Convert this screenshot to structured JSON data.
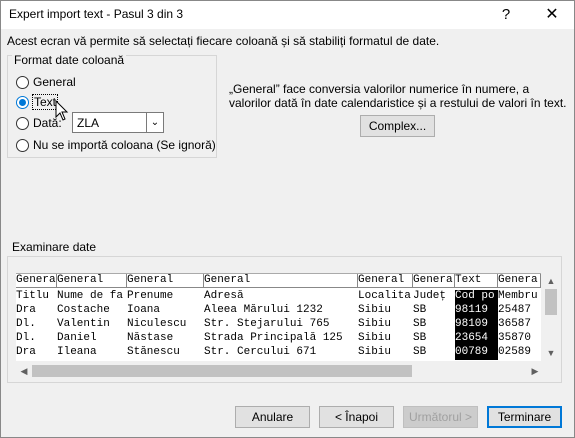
{
  "window": {
    "title": "Expert import text - Pasul 3 din 3",
    "help_icon": "?",
    "close_icon": "✕"
  },
  "intro": "Acest ecran vă permite să selectați fiecare coloană și să stabiliți formatul de date.",
  "column_format": {
    "legend": "Format date coloană",
    "options": {
      "general": "General",
      "text": "Text",
      "date": "Dată:",
      "skip": "Nu se importă coloana (Se ignoră)"
    },
    "selected": "text",
    "date_format": "ZLA"
  },
  "description": "„General” face conversia valorilor numerice în numere, a valorilor dată în date calendaristice și a restului de valori în text.",
  "complex_button": "Complex...",
  "preview": {
    "label": "Examinare date",
    "headers": [
      "Genera",
      "General",
      "General",
      "General",
      "General",
      "Genera",
      "Text",
      "Genera"
    ],
    "rows": [
      [
        "Titlu",
        "Nume de fa",
        "Prenume",
        "Adresă",
        "Localita",
        "Județ",
        "Cod po",
        "Membru"
      ],
      [
        "Dra",
        "Costache",
        "Ioana",
        "Aleea Mărului 1232",
        "Sibiu",
        "SB",
        "98119",
        "25487"
      ],
      [
        "Dl.",
        "Valentin",
        "Niculescu",
        "Str. Stejarului 765",
        "Sibiu",
        "SB",
        "98109",
        "36587"
      ],
      [
        "Dl.",
        "Daniel",
        "Năstase",
        "Strada Principală 125",
        "Sibiu",
        "SB",
        "23654",
        "35870"
      ],
      [
        "Dra",
        "Ileana",
        "Stănescu",
        "Str. Cercului 671",
        "Sibiu",
        "SB",
        "00789",
        "02589"
      ]
    ],
    "selected_column": 6
  },
  "footer": {
    "cancel": "Anulare",
    "back": "< Înapoi",
    "next": "Următorul >",
    "finish": "Terminare"
  }
}
